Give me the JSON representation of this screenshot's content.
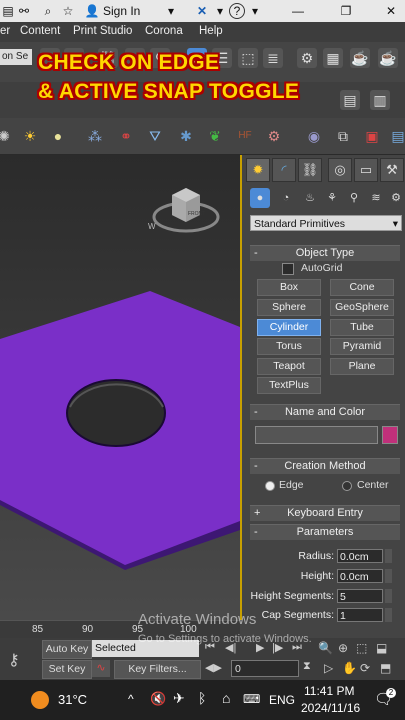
{
  "titlebar": {
    "signin_label": "Sign In",
    "help_icon_label": "?",
    "window_controls": [
      "minimize",
      "restore",
      "close"
    ]
  },
  "menubar": {
    "items": [
      "er",
      "Content",
      "Print Studio",
      "Corona",
      "Help"
    ]
  },
  "toolbar1": {
    "selection_set_partial": "on Se"
  },
  "caption": {
    "line1": "CHECK ON EDGE",
    "line2": "& ACTIVE SNAP TOGGLE"
  },
  "viewcube": {
    "front_label": "FRONT",
    "w_label": "W"
  },
  "panel": {
    "dropdown_value": "Standard Primitives",
    "object_type": {
      "header": "Object Type",
      "autogrid_label": "AutoGrid",
      "buttons": [
        "Box",
        "Cone",
        "Sphere",
        "GeoSphere",
        "Cylinder",
        "Tube",
        "Torus",
        "Pyramid",
        "Teapot",
        "Plane",
        "TextPlus"
      ],
      "active": "Cylinder"
    },
    "name_color": {
      "header": "Name and Color",
      "swatch_color": "#c0307a"
    },
    "creation_method": {
      "header": "Creation Method",
      "options": [
        "Edge",
        "Center"
      ],
      "selected": "Edge"
    },
    "keyboard_entry": {
      "header": "Keyboard Entry"
    },
    "parameters": {
      "header": "Parameters",
      "rows": [
        {
          "label": "Radius:",
          "value": "0.0cm"
        },
        {
          "label": "Height:",
          "value": "0.0cm"
        },
        {
          "label": "Height Segments:",
          "value": "5"
        },
        {
          "label": "Cap Segments:",
          "value": "1"
        }
      ]
    }
  },
  "timeline": {
    "ticks": [
      "85",
      "90",
      "95",
      "100"
    ]
  },
  "bottom": {
    "auto_key": "Auto Key",
    "set_key": "Set Key",
    "selected_value": "Selected",
    "key_filters": "Key Filters...",
    "frame_value": "0"
  },
  "watermark": {
    "title": "Activate Windows",
    "subtitle": "Go to Settings to activate Windows."
  },
  "taskbar": {
    "temperature": "31°C",
    "language": "ENG",
    "time": "11:41 PM",
    "date": "2024/11/16",
    "notification_count": "2"
  },
  "colors": {
    "plane_fill": "#7a2fc8",
    "accent_blue": "#4c8ad6",
    "caption_yellow": "#ffd800",
    "caption_outline": "#aa0000",
    "viewport_border": "#c8a000"
  }
}
